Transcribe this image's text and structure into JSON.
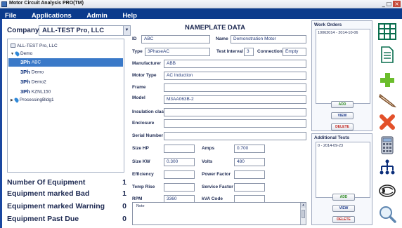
{
  "window": {
    "title": "Motor Circuit Analysis PRO(TM)"
  },
  "menu": {
    "items": [
      "File",
      "Applications",
      "Admin",
      "Help"
    ]
  },
  "company": {
    "label": "Company",
    "selected": "ALL-TEST Pro, LLC"
  },
  "tree": {
    "items": [
      {
        "label": "ALL-TEST Pro, LLC",
        "type": "company"
      },
      {
        "label": "Demo",
        "type": "location"
      },
      {
        "label": "ABC",
        "type": "motor",
        "selected": true
      },
      {
        "label": "Demo",
        "type": "motor"
      },
      {
        "label": "Demo2",
        "type": "motor"
      },
      {
        "label": "KZNL150",
        "type": "motor"
      },
      {
        "label": "ProcessingBldg1",
        "type": "location"
      }
    ],
    "motor_icon_text": "3Ph"
  },
  "stats": [
    {
      "label": "Number Of Equipment",
      "value": "1"
    },
    {
      "label": "Equipment marked Bad",
      "value": "1"
    },
    {
      "label": "Equipment marked Warning",
      "value": "0"
    },
    {
      "label": "Equipment Past Due",
      "value": "0"
    }
  ],
  "nameplate": {
    "title": "NAMEPLATE DATA",
    "id": {
      "label": "ID",
      "value": "ABC"
    },
    "name": {
      "label": "Name",
      "value": "Demonstration Motor"
    },
    "type": {
      "label": "Type",
      "value": "3PhaseAC"
    },
    "test_interval": {
      "label": "Test Interval",
      "value": "3"
    },
    "connection": {
      "label": "Connection",
      "value": "Empty"
    },
    "manufacturer": {
      "label": "Manufacturer",
      "value": "ABB"
    },
    "motor_type": {
      "label": "Motor Type",
      "value": "AC Induction"
    },
    "frame": {
      "label": "Frame",
      "value": ""
    },
    "model": {
      "label": "Model",
      "value": "M3AA063B-2"
    },
    "insulation_class": {
      "label": "Insulation class",
      "value": ""
    },
    "enclosure": {
      "label": "Enclosure",
      "value": ""
    },
    "serial_number": {
      "label": "Serial Number",
      "value": ""
    },
    "size_hp": {
      "label": "Size HP",
      "value": ""
    },
    "amps": {
      "label": "Amps",
      "value": "0.700"
    },
    "size_kw": {
      "label": "Size KW",
      "value": "0.300"
    },
    "volts": {
      "label": "Volts",
      "value": "480"
    },
    "efficiency": {
      "label": "Efficiency",
      "value": ""
    },
    "power_factor": {
      "label": "Power Factor",
      "value": ""
    },
    "temp_rise": {
      "label": "Temp Rise",
      "value": ""
    },
    "service_factor": {
      "label": "Service Factor",
      "value": ""
    },
    "rpm": {
      "label": "RPM",
      "value": "3360"
    },
    "kva_code": {
      "label": "kVA Code",
      "value": ""
    },
    "note": {
      "label": "Note",
      "value": ""
    }
  },
  "work_orders": {
    "title": "Work Orders",
    "items": [
      "10062014 - 2014-10-06"
    ],
    "add": "ADD",
    "view": "VIEW",
    "delete": "DELETE"
  },
  "additional_tests": {
    "title": "Additional Tests",
    "items": [
      "0 - 2014-09-23"
    ],
    "add": "ADD",
    "view": "VIEW",
    "delete": "DELETE"
  },
  "toolbar": {
    "icons": [
      "grid-icon",
      "document-icon",
      "add-icon",
      "edit-pencil-icon",
      "delete-x-icon",
      "calculator-icon",
      "hierarchy-icon",
      "motor-icon",
      "search-icon"
    ]
  },
  "colors": {
    "menu_bar": "#0b3b8c",
    "selection": "#3a79c8",
    "text": "#1e2a52",
    "add": "#2f8a25",
    "delete": "#c0231d"
  }
}
